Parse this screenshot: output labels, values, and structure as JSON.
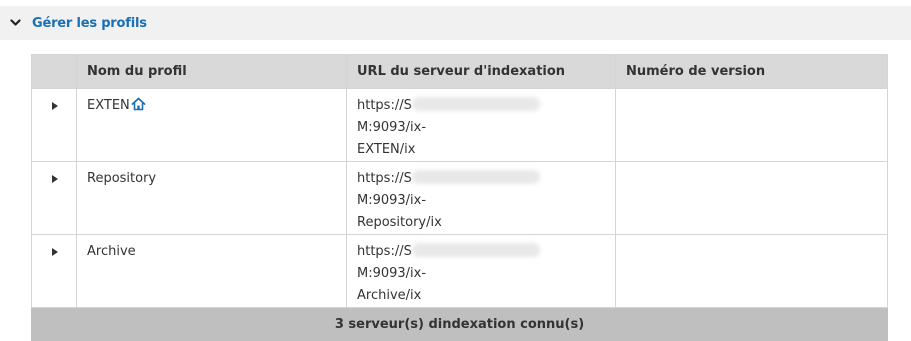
{
  "section": {
    "title": "Gérer les profils",
    "chevron_icon": "chevron-down-icon"
  },
  "table": {
    "columns": [
      "",
      "Nom du profil",
      "URL du serveur d'indexation",
      "Numéro de version"
    ],
    "rows": [
      {
        "name": "EXTEN",
        "name_icon": "home-icon",
        "url_prefix": "https://S",
        "url_suffix_line1": "M:9093/ix-",
        "url_line2": "EXTEN/ix",
        "version": ""
      },
      {
        "name": "Repository",
        "name_icon": "",
        "url_prefix": "https://S",
        "url_suffix_line1": "M:9093/ix-",
        "url_line2": "Repository/ix",
        "version": ""
      },
      {
        "name": "Archive",
        "name_icon": "",
        "url_prefix": "https://S",
        "url_suffix_line1": "M:9093/ix-",
        "url_line2": "Archive/ix",
        "version": ""
      }
    ],
    "footer": "3 serveur(s) dindexation connu(s)"
  },
  "colors": {
    "link_blue": "#1a6fb5",
    "header_bg": "#d9d9d9",
    "footer_bg": "#bfbfbf",
    "section_bg": "#f1f1f1"
  }
}
